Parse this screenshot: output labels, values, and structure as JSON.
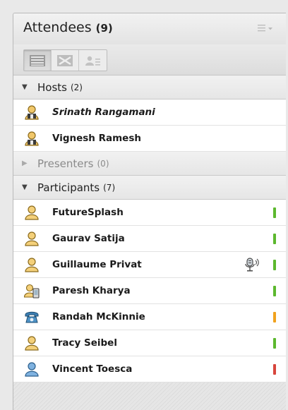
{
  "panel": {
    "title": "Attendees",
    "count": "(9)",
    "menu_icon": "list-menu-icon"
  },
  "view_buttons": [
    {
      "name": "list-view",
      "icon": "list-view-icon",
      "active": true
    },
    {
      "name": "grid-view",
      "icon": "grid-view-icon",
      "active": false
    },
    {
      "name": "detail-view",
      "icon": "user-detail-icon",
      "active": false
    }
  ],
  "hosts": {
    "label": "Hosts",
    "count": "(2)",
    "items": [
      {
        "name": "Srinath Rangamani",
        "icon": "host-icon",
        "italic": true
      },
      {
        "name": "Vignesh Ramesh",
        "icon": "host-icon",
        "italic": false
      }
    ]
  },
  "presenters": {
    "label": "Presenters",
    "count": "(0)"
  },
  "participants": {
    "label": "Participants",
    "count": "(7)",
    "items": [
      {
        "name": "FutureSplash",
        "icon": "participant-icon",
        "status": "#5cb82e"
      },
      {
        "name": "Gaurav Satija",
        "icon": "participant-icon",
        "status": "#5cb82e"
      },
      {
        "name": "Guillaume Privat",
        "icon": "participant-icon",
        "status": "#5cb82e",
        "speaking": true
      },
      {
        "name": "Paresh Kharya",
        "icon": "mobile-participant-icon",
        "status": "#5cb82e"
      },
      {
        "name": "Randah McKinnie",
        "icon": "phone-icon",
        "status": "#f0a21e"
      },
      {
        "name": "Tracy Seibel",
        "icon": "participant-icon",
        "status": "#5cb82e"
      },
      {
        "name": "Vincent Toesca",
        "icon": "participant-blue-icon",
        "status": "#d7453c"
      }
    ]
  },
  "colors": {
    "status_green": "#5cb82e",
    "status_orange": "#f0a21e",
    "status_red": "#d7453c"
  }
}
